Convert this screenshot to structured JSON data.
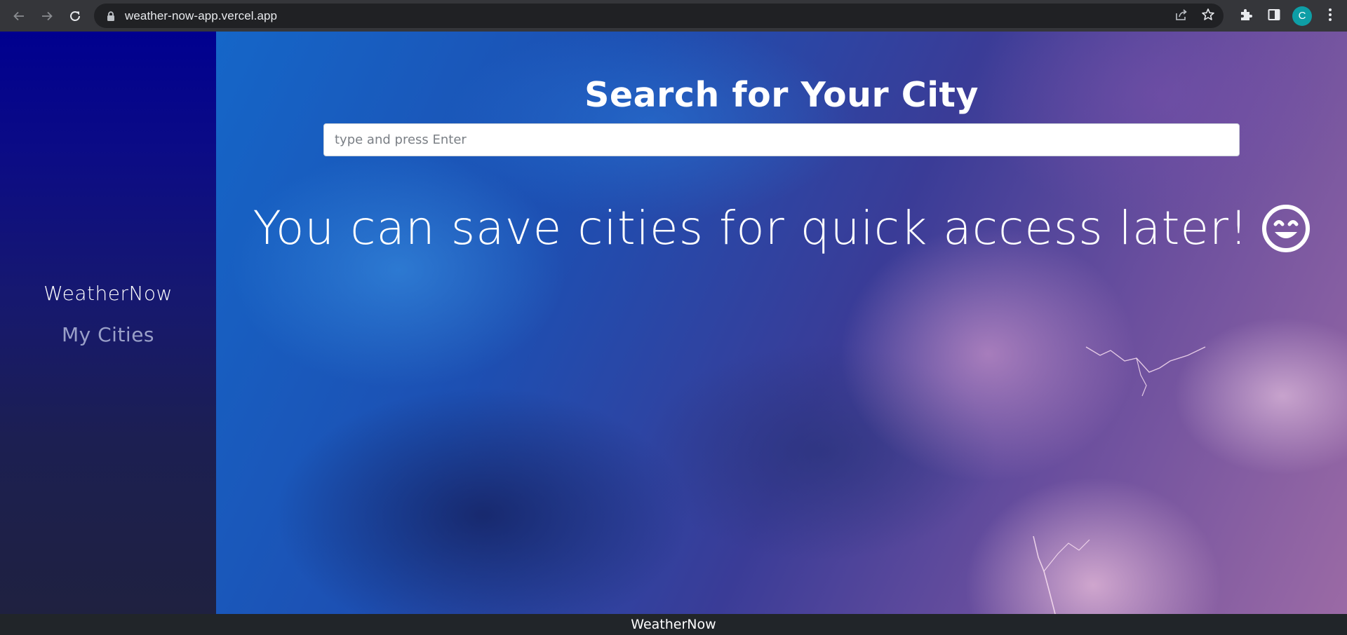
{
  "browser": {
    "url": "weather-now-app.vercel.app",
    "profile_initial": "C",
    "icons": {
      "back": "arrow-left-icon",
      "forward": "arrow-right-icon",
      "reload": "reload-icon",
      "lock": "lock-icon",
      "share": "share-icon",
      "bookmark": "star-icon",
      "extensions": "puzzle-icon",
      "side_panel": "side-panel-icon",
      "menu": "kebab-menu-icon"
    },
    "colors": {
      "chrome_bg": "#35363a",
      "omnibox_bg": "#202124",
      "avatar_bg": "#0e9ea6"
    }
  },
  "sidebar": {
    "brand": "WeatherNow",
    "links": [
      {
        "label": "My Cities"
      }
    ]
  },
  "main": {
    "search_title": "Search for Your City",
    "search": {
      "value": "",
      "placeholder": "type and press Enter"
    },
    "message": "You can save cities for quick access later!",
    "message_icon": "smile-icon",
    "background": "storm-clouds-lightning"
  },
  "footer": {
    "text": "WeatherNow"
  }
}
